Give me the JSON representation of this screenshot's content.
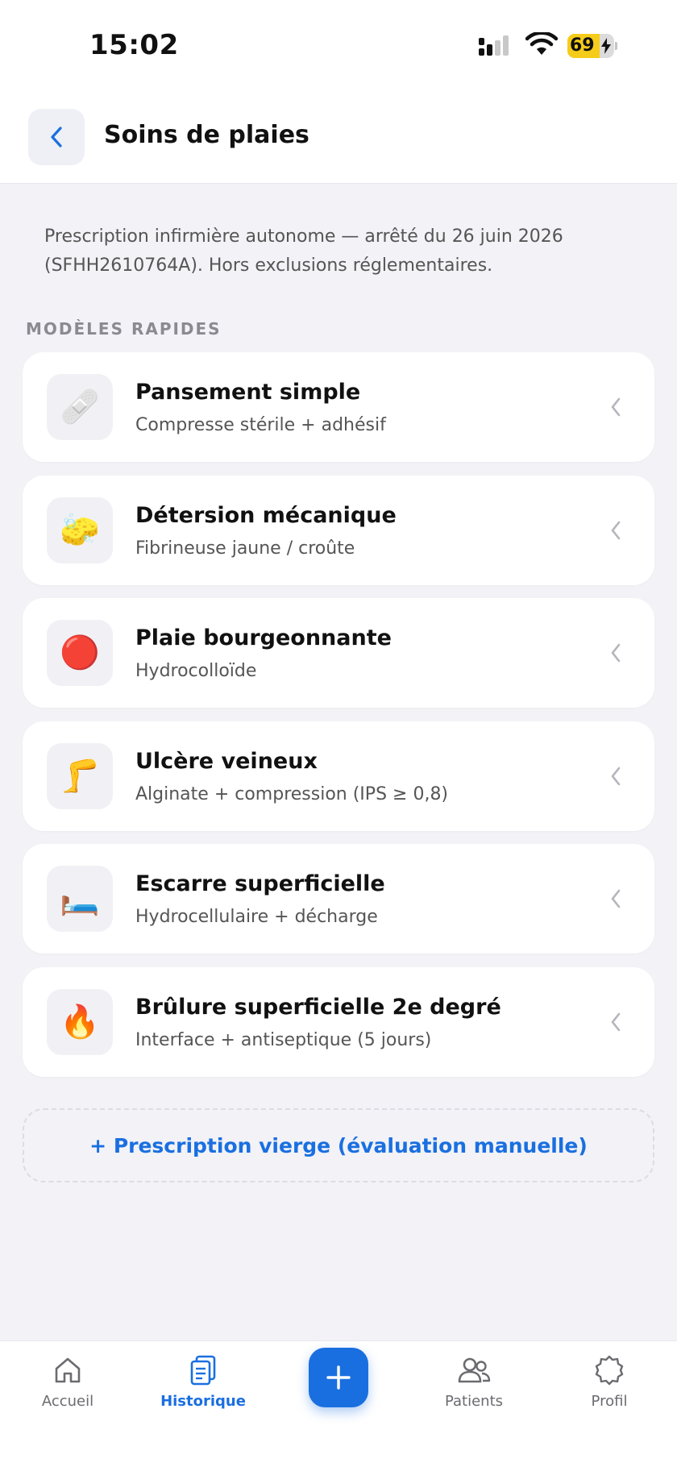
{
  "status_bar": {
    "time": "15:02",
    "battery_percent": "69",
    "battery_level": 0.69,
    "icons": [
      "signal-icon",
      "wifi-icon",
      "battery-charging-icon"
    ]
  },
  "header": {
    "title": "Soins de plaies",
    "back_icon": "chevron-left-icon"
  },
  "notice": "Prescription infirmière autonome — arrêté du 26 juin 2026 (SFHH2610764A). Hors exclusions réglementaires.",
  "section_title": "MODÈLES RAPIDES",
  "templates": [
    {
      "icon": "🩹",
      "icon_name": "bandage-icon",
      "title": "Pansement simple",
      "subtitle": "Compresse stérile + adhésif"
    },
    {
      "icon": "🧽",
      "icon_name": "sponge-icon",
      "title": "Détersion mécanique",
      "subtitle": "Fibrineuse jaune / croûte"
    },
    {
      "icon": "🔴",
      "icon_name": "red-circle-icon",
      "title": "Plaie bourgeonnante",
      "subtitle": "Hydrocolloïde"
    },
    {
      "icon": "🦵",
      "icon_name": "leg-icon",
      "title": "Ulcère veineux",
      "subtitle": "Alginate + compression (IPS ≥ 0,8)"
    },
    {
      "icon": "🛏️",
      "icon_name": "bed-icon",
      "title": "Escarre superficielle",
      "subtitle": "Hydrocellulaire + décharge"
    },
    {
      "icon": "🔥",
      "icon_name": "fire-icon",
      "title": "Brûlure superficielle 2e degré",
      "subtitle": "Interface + antiseptique (5 jours)"
    }
  ],
  "blank_prescription_label": "+ Prescription vierge (évaluation manuelle)",
  "tabbar": {
    "items": [
      {
        "label": "Accueil",
        "icon": "home-icon",
        "active": false
      },
      {
        "label": "Historique",
        "icon": "clipboard-icon",
        "active": true
      },
      {
        "label": "",
        "icon": "plus-icon",
        "active": false
      },
      {
        "label": "Patients",
        "icon": "users-icon",
        "active": false
      },
      {
        "label": "Profil",
        "icon": "gear-icon",
        "active": false
      }
    ]
  },
  "colors": {
    "accent": "#1a6fe0",
    "background": "#f2f2f7",
    "card": "#ffffff",
    "battery": "#f6cc1b"
  }
}
